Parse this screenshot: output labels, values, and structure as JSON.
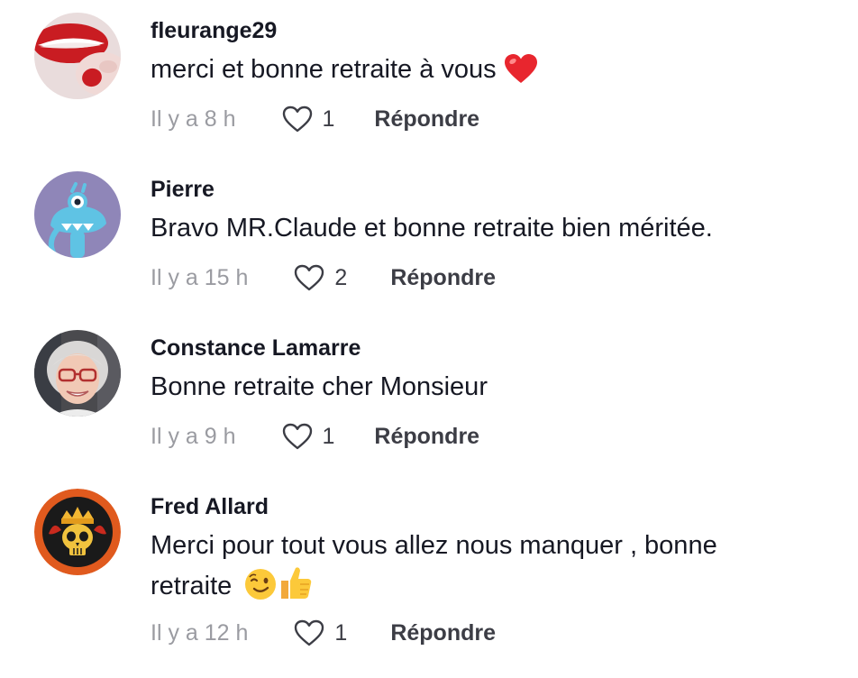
{
  "comments": [
    {
      "username": "fleurange29",
      "text": "merci et bonne retraite à vous",
      "emoji": "heart",
      "time": "Il y a 8 h",
      "likes": "1",
      "reply_label": "Répondre",
      "avatar": "lips-avatar"
    },
    {
      "username": "Pierre",
      "text": "Bravo MR.Claude et bonne retraite bien méritée.",
      "time": "Il y a 15 h",
      "likes": "2",
      "reply_label": "Répondre",
      "avatar": "blue-monster-avatar"
    },
    {
      "username": "Constance Lamarre",
      "text": "Bonne retraite cher Monsieur",
      "time": "Il y a 9 h",
      "likes": "1",
      "reply_label": "Répondre",
      "avatar": "elderly-woman-avatar"
    },
    {
      "username": "Fred Allard",
      "text_line1": "Merci pour tout vous allez nous manquer , bonne",
      "text_line2": "retraite",
      "emoji": "wink-thumbs-up",
      "time": "Il y a 12 h",
      "likes": "1",
      "reply_label": "Répondre",
      "avatar": "skull-crown-avatar"
    }
  ],
  "colors": {
    "text": "#161823",
    "muted": "#9a9ba1",
    "action": "#3c3d45",
    "heart_emoji": "#e8262e",
    "avatar_pierre_bg": "#8f86b8",
    "avatar_fred_ring": "#e05a1e"
  }
}
